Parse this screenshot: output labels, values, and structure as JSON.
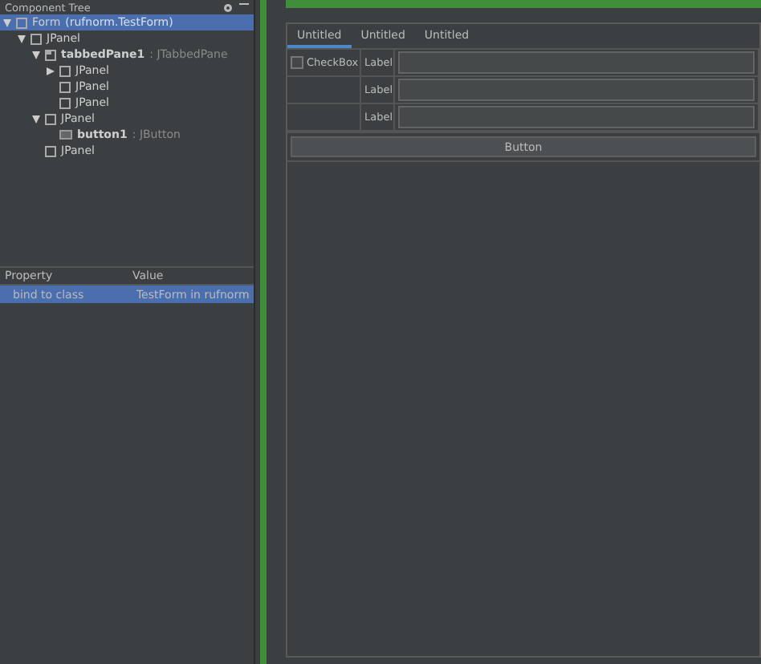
{
  "tree_panel": {
    "title": "Component Tree",
    "items": [
      {
        "kind": "form",
        "name": "Form",
        "type": "(rufnorm.TestForm)",
        "selected": true,
        "expanded": true,
        "children": [
          {
            "kind": "panel",
            "name": "JPanel",
            "selected": false,
            "expanded": true,
            "children": [
              {
                "kind": "tabbed",
                "name": "tabbedPane1",
                "type": ": JTabbedPane",
                "selected": false,
                "expanded": true,
                "children": [
                  {
                    "kind": "panel",
                    "name": "JPanel",
                    "selected": false,
                    "expanded": false
                  },
                  {
                    "kind": "panel",
                    "name": "JPanel",
                    "selected": false
                  },
                  {
                    "kind": "panel",
                    "name": "JPanel",
                    "selected": false
                  }
                ]
              },
              {
                "kind": "panel",
                "name": "JPanel",
                "selected": false,
                "expanded": true,
                "children": [
                  {
                    "kind": "button",
                    "name": "button1",
                    "type": ": JButton",
                    "selected": false
                  }
                ]
              },
              {
                "kind": "panel",
                "name": "JPanel",
                "selected": false
              }
            ]
          }
        ]
      }
    ]
  },
  "properties": {
    "columns": [
      "Property",
      "Value"
    ],
    "rows": [
      {
        "property": "bind to class",
        "value": "TestForm in rufnorm",
        "selected": true
      }
    ]
  },
  "form": {
    "tabs": [
      {
        "label": "Untitled",
        "selected": true
      },
      {
        "label": "Untitled",
        "selected": false
      },
      {
        "label": "Untitled",
        "selected": false
      }
    ],
    "checkbox": {
      "label": "CheckBox",
      "checked": false
    },
    "labels": [
      "Label",
      "Label",
      "Label"
    ],
    "button": "Button"
  }
}
